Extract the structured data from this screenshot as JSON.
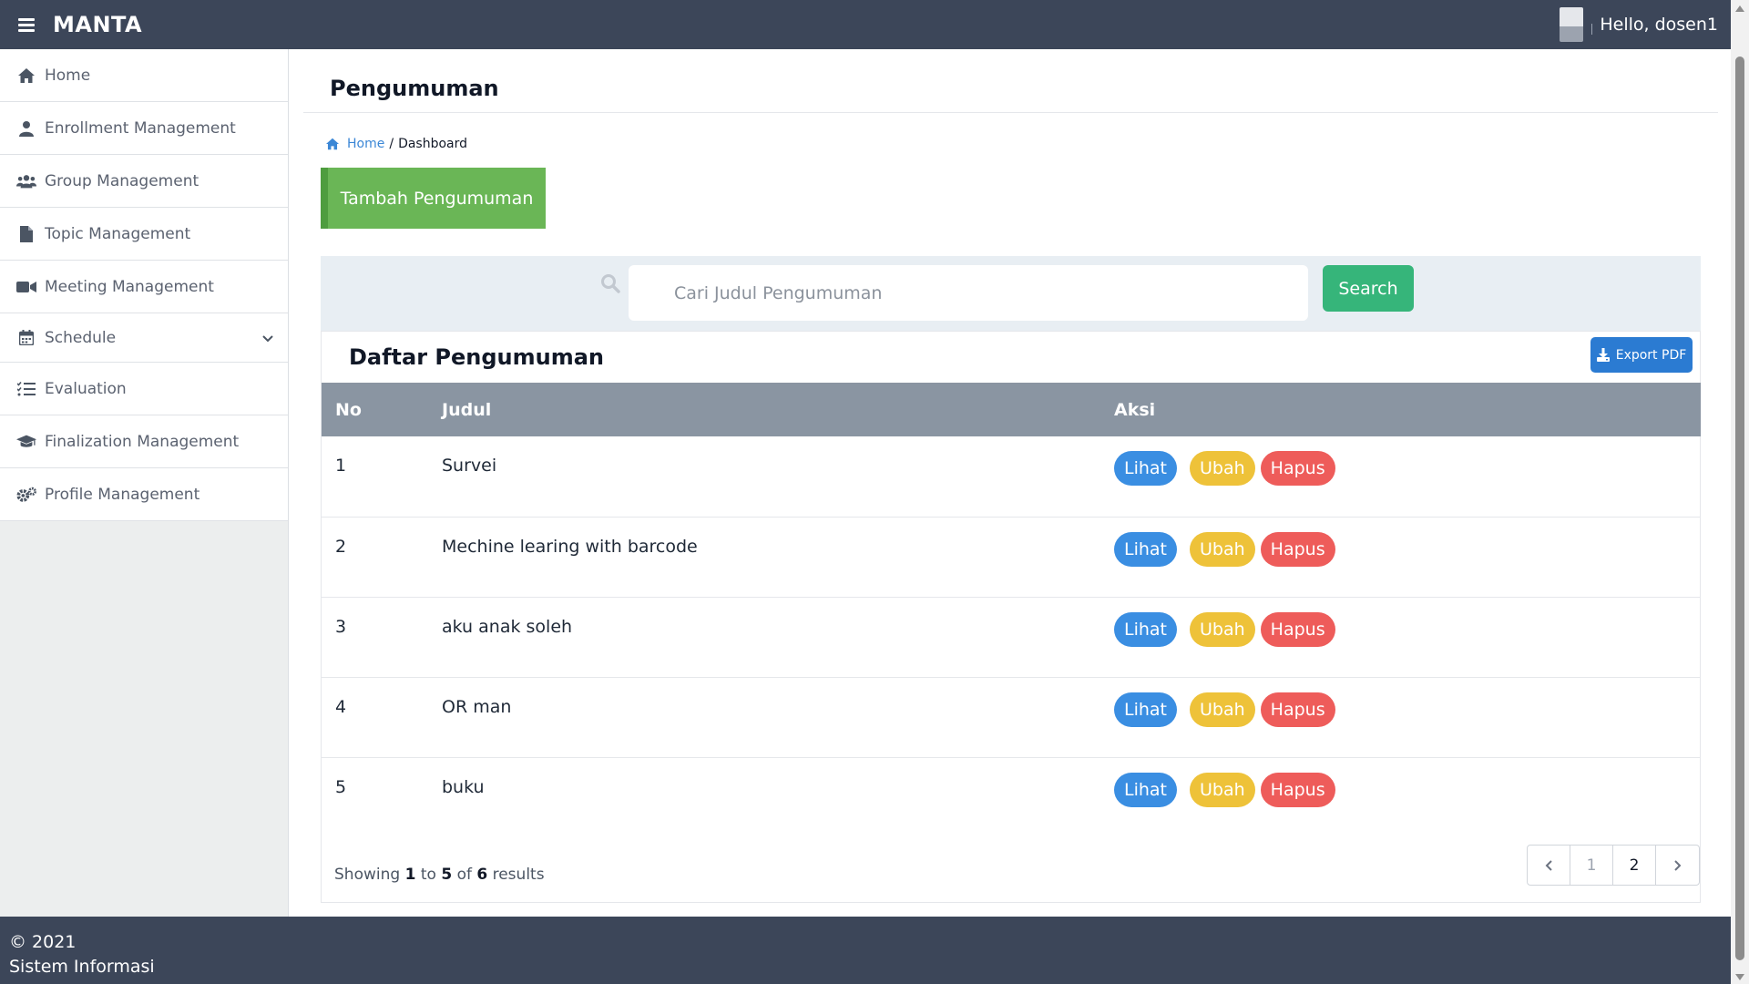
{
  "app": {
    "brand": "MANTA",
    "greeting": "Hello, dosen1"
  },
  "sidebar": {
    "items": [
      {
        "label": "Home",
        "icon": "home-icon"
      },
      {
        "label": "Enrollment Management",
        "icon": "user-icon"
      },
      {
        "label": "Group Management",
        "icon": "users-icon"
      },
      {
        "label": "Topic Management",
        "icon": "file-icon"
      },
      {
        "label": "Meeting Management",
        "icon": "video-icon"
      },
      {
        "label": "Schedule",
        "icon": "calendar-icon"
      },
      {
        "label": "Evaluation",
        "icon": "list-check-icon"
      },
      {
        "label": "Finalization Management",
        "icon": "graduation-cap-icon"
      },
      {
        "label": "Profile Management",
        "icon": "gears-icon"
      }
    ]
  },
  "page": {
    "title": "Pengumuman",
    "breadcrumb": {
      "home": "Home",
      "sep": "/",
      "current": "Dashboard"
    },
    "add_button": "Tambah Pengumuman",
    "search": {
      "placeholder": "Cari Judul Pengumuman",
      "button": "Search"
    }
  },
  "list": {
    "title": "Daftar Pengumuman",
    "export_button": "Export PDF",
    "columns": {
      "no": "No",
      "judul": "Judul",
      "aksi": "Aksi"
    },
    "actions": {
      "view": "Lihat",
      "edit": "Ubah",
      "delete": "Hapus"
    },
    "rows": [
      {
        "no": "1",
        "judul": "Survei"
      },
      {
        "no": "2",
        "judul": "Mechine learing with barcode"
      },
      {
        "no": "3",
        "judul": "aku anak soleh"
      },
      {
        "no": "4",
        "judul": "OR man"
      },
      {
        "no": "5",
        "judul": "buku"
      }
    ],
    "showing": {
      "prefix": "Showing",
      "from": "1",
      "to_word": "to",
      "to": "5",
      "of_word": "of",
      "total": "6",
      "suffix": "results"
    },
    "pagination": {
      "pages": [
        "1",
        "2"
      ]
    }
  },
  "footer": {
    "copyright": "© 2021",
    "org": "Sistem Informasi"
  },
  "colors": {
    "topbar": "#3c4659",
    "add_button": "#6ab656",
    "search_button": "#36b57a",
    "export_button": "#2b7bd2",
    "view": "#3a8ee2",
    "edit": "#eec239",
    "delete": "#ee5c5a",
    "table_header": "#8a95a2"
  }
}
